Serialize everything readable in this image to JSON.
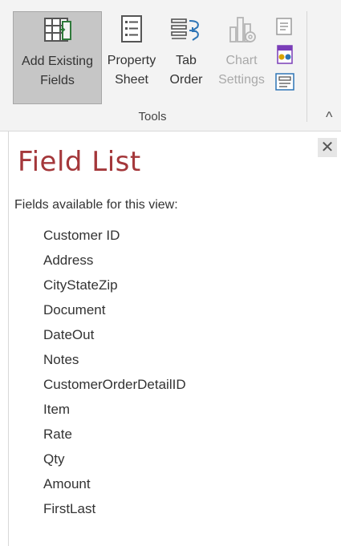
{
  "ribbon": {
    "buttons": [
      {
        "label_line1": "Add Existing",
        "label_line2": "Fields",
        "icon": "add-existing-fields-icon",
        "selected": true,
        "enabled": true
      },
      {
        "label_line1": "Property",
        "label_line2": "Sheet",
        "icon": "property-sheet-icon",
        "selected": false,
        "enabled": true
      },
      {
        "label_line1": "Tab",
        "label_line2": "Order",
        "icon": "tab-order-icon",
        "selected": false,
        "enabled": true
      },
      {
        "label_line1": "Chart",
        "label_line2": "Settings",
        "icon": "chart-settings-icon",
        "selected": false,
        "enabled": false
      }
    ],
    "small_icons": [
      "view-code-icon",
      "convert-macros-icon",
      "subform-icon"
    ],
    "group_label": "Tools",
    "collapse_glyph": "^"
  },
  "pane": {
    "close_glyph": "✕",
    "title": "Field List",
    "subtitle": "Fields available for this view:",
    "fields": [
      "Customer ID",
      "Address",
      "CityStateZip",
      "Document",
      "DateOut",
      "Notes",
      "CustomerOrderDetailID",
      "Item",
      "Rate",
      "Qty",
      "Amount",
      "FirstLast"
    ]
  },
  "colors": {
    "title": "#a4373a",
    "selected_button": "#c6c6c6",
    "ribbon_bg": "#f3f3f3"
  }
}
